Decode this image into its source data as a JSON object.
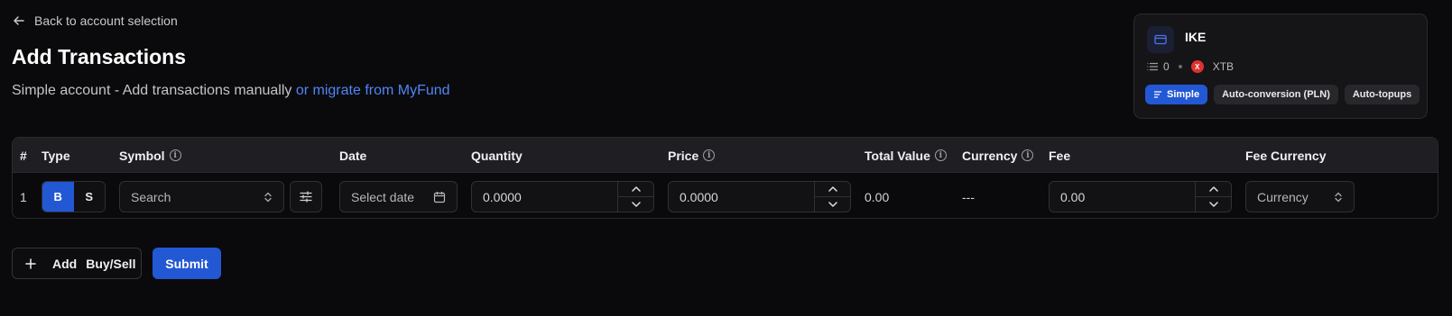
{
  "nav": {
    "back_label": "Back to account selection"
  },
  "header": {
    "title": "Add Transactions",
    "subtitle": "Simple account - Add transactions manually",
    "migrate_link": "or migrate from MyFund"
  },
  "account": {
    "name": "IKE",
    "transaction_count": "0",
    "broker": "XTB",
    "broker_logo_text": "X",
    "tags": [
      "Simple",
      "Auto-conversion (PLN)",
      "Auto-topups"
    ],
    "active_tag": "Simple"
  },
  "table": {
    "columns": [
      "#",
      "Type",
      "Symbol",
      "Date",
      "Quantity",
      "Price",
      "Total Value",
      "Currency",
      "Fee",
      "Fee Currency"
    ],
    "rows": [
      {
        "index": "1",
        "buy_label": "B",
        "sell_label": "S",
        "selected_type": "B",
        "symbol_placeholder": "Search",
        "date_placeholder": "Select date",
        "quantity_placeholder": "0.0000",
        "price_placeholder": "0.0000",
        "total_value": "0.00",
        "currency": "---",
        "fee_placeholder": "0.00",
        "fee_currency_placeholder": "Currency"
      }
    ]
  },
  "actions": {
    "add_label": "Add",
    "add_suffix": "Buy/Sell",
    "submit_label": "Submit"
  },
  "colors": {
    "background": "#0a0a0c",
    "accent": "#2358d4",
    "link": "#4f86f7",
    "broker_red": "#e0312d"
  }
}
